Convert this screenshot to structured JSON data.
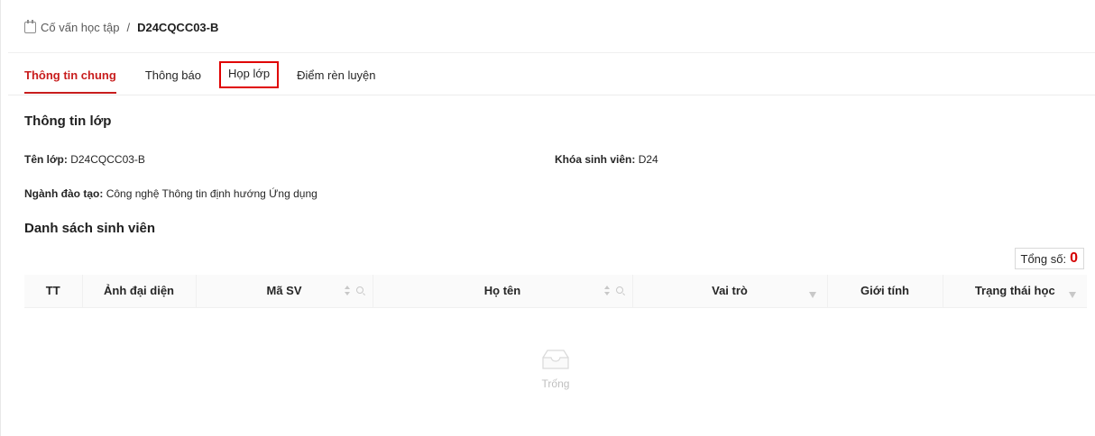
{
  "breadcrumb": {
    "icon": "calendar-icon",
    "parent": "Cố vấn học tập",
    "separator": "/",
    "current": "D24CQCC03-B"
  },
  "tabs": [
    {
      "label": "Thông tin chung",
      "active": true
    },
    {
      "label": "Thông báo",
      "active": false
    },
    {
      "label": "Họp lớp",
      "active": false,
      "highlighted": true
    },
    {
      "label": "Điểm rèn luyện",
      "active": false
    }
  ],
  "class_info": {
    "title": "Thông tin lớp",
    "class_name_label": "Tên lớp",
    "class_name_value": "D24CQCC03-B",
    "cohort_label": "Khóa sinh viên",
    "cohort_value": "D24",
    "major_label": "Ngành đào tạo",
    "major_value": "Công nghệ Thông tin định hướng Ứng dụng"
  },
  "students": {
    "title": "Danh sách sinh viên",
    "total_label": "Tổng số:",
    "total_value": "0",
    "columns": [
      {
        "label": "TT",
        "sortable": false,
        "searchable": false,
        "filterable": false
      },
      {
        "label": "Ảnh đại diện",
        "sortable": false,
        "searchable": false,
        "filterable": false
      },
      {
        "label": "Mã SV",
        "sortable": true,
        "searchable": true,
        "filterable": false
      },
      {
        "label": "Họ tên",
        "sortable": true,
        "searchable": true,
        "filterable": false
      },
      {
        "label": "Vai trò",
        "sortable": false,
        "searchable": false,
        "filterable": true
      },
      {
        "label": "Giới tính",
        "sortable": false,
        "searchable": false,
        "filterable": false
      },
      {
        "label": "Trạng thái học",
        "sortable": false,
        "searchable": false,
        "filterable": true
      }
    ],
    "rows": [],
    "empty_text": "Trống"
  },
  "colors": {
    "accent": "#c81d1d",
    "highlight_box": "#e00000",
    "total_number": "#d40000"
  }
}
